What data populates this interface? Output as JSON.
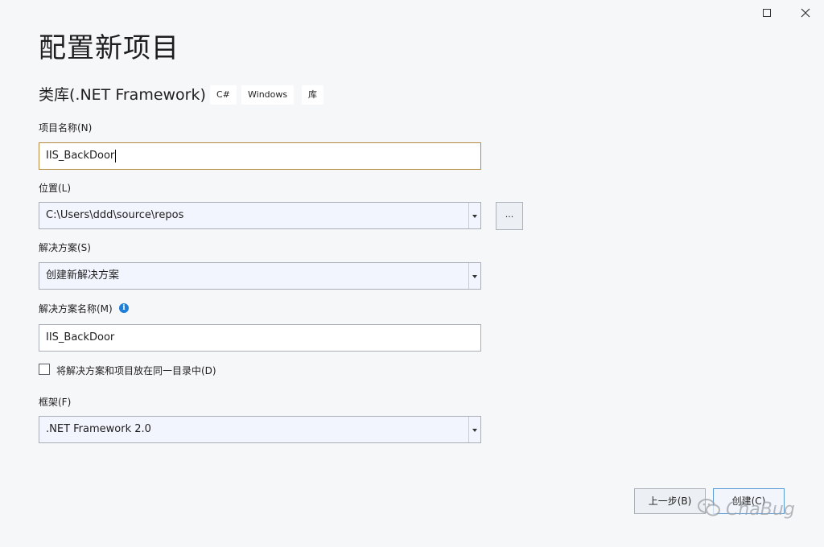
{
  "window": {
    "maximize_icon": "maximize-icon",
    "close_icon": "close-icon"
  },
  "header": {
    "title": "配置新项目",
    "template_name": "类库(.NET Framework)",
    "tags": [
      "C#",
      "Windows",
      "库"
    ]
  },
  "form": {
    "project_name": {
      "label": "项目名称(N)",
      "value": "IIS_BackDoor"
    },
    "location": {
      "label": "位置(L)",
      "value": "C:\\Users\\ddd\\source\\repos",
      "browse_label": "..."
    },
    "solution": {
      "label": "解决方案(S)",
      "value": "创建新解决方案"
    },
    "solution_name": {
      "label": "解决方案名称(M)",
      "value": "IIS_BackDoor",
      "info_icon": "info-icon"
    },
    "same_dir": {
      "label": "将解决方案和项目放在同一目录中(D)",
      "checked": false
    },
    "framework": {
      "label": "框架(F)",
      "value": ".NET Framework 2.0"
    }
  },
  "footer": {
    "back_label": "上一步(B)",
    "create_label": "创建(C)"
  },
  "watermark": {
    "text": "ChaBug"
  },
  "colors": {
    "accent": "#5b9bd5",
    "focus_border": "#b58a3e",
    "info": "#1f7fd8"
  }
}
